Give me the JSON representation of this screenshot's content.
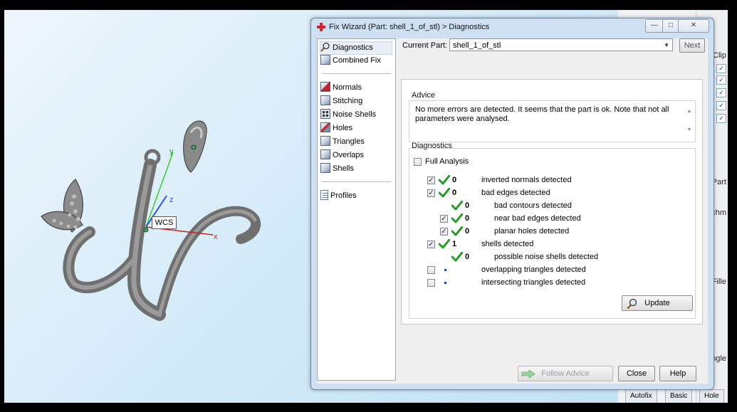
{
  "viewport": {
    "wcs_label": "WCS",
    "axis_x": "x",
    "axis_y": "y",
    "axis_z": "z"
  },
  "background_app": {
    "labels": [
      "Clip",
      "Part",
      "chm",
      "Fille",
      "ngle"
    ],
    "tabs": [
      "Autofix",
      "Basic",
      "Hole"
    ]
  },
  "dialog": {
    "title": "Fix Wizard (Part: shell_1_of_stl) > Diagnostics",
    "window_buttons": {
      "minimize": "—",
      "maximize": "□",
      "close": "✕"
    },
    "nav": {
      "top": [
        {
          "label": "Diagnostics",
          "icon": "magnifier-icon",
          "selected": true
        },
        {
          "label": "Combined Fix",
          "icon": "cube-icon"
        }
      ],
      "middle": [
        {
          "label": "Normals",
          "icon": "normals-cube-icon"
        },
        {
          "label": "Stitching",
          "icon": "stitching-cube-icon"
        },
        {
          "label": "Noise Shells",
          "icon": "noise-shells-icon"
        },
        {
          "label": "Holes",
          "icon": "holes-cube-icon"
        },
        {
          "label": "Triangles",
          "icon": "triangles-cube-icon"
        },
        {
          "label": "Overlaps",
          "icon": "overlaps-cube-icon"
        },
        {
          "label": "Shells",
          "icon": "shells-cube-icon"
        }
      ],
      "bottom": [
        {
          "label": "Profiles",
          "icon": "profiles-doc-icon"
        }
      ]
    },
    "current_part": {
      "label": "Current Part:",
      "value": "shell_1_of_stl",
      "next_label": "Next"
    },
    "advice": {
      "title": "Advice",
      "text": "No more errors are detected. It seems that the part is ok. Note that not all parameters were analysed."
    },
    "diagnostics": {
      "title": "Diagnostics",
      "full_analysis_label": "Full Analysis",
      "full_analysis_checked": false,
      "rows": [
        {
          "level": 0,
          "has_checkbox": true,
          "checked": true,
          "status": "ok",
          "count": "0",
          "label": "inverted normals detected"
        },
        {
          "level": 0,
          "has_checkbox": true,
          "checked": true,
          "status": "ok",
          "count": "0",
          "label": "bad edges detected"
        },
        {
          "level": 1,
          "has_checkbox": false,
          "checked": false,
          "status": "ok",
          "count": "0",
          "label": "bad contours detected"
        },
        {
          "level": 1,
          "has_checkbox": true,
          "checked": true,
          "status": "ok",
          "count": "0",
          "label": "near bad edges detected"
        },
        {
          "level": 1,
          "has_checkbox": true,
          "checked": true,
          "status": "ok",
          "count": "0",
          "label": "planar holes detected"
        },
        {
          "level": 0,
          "has_checkbox": true,
          "checked": true,
          "status": "ok",
          "count": "1",
          "label": "shells detected"
        },
        {
          "level": 1,
          "has_checkbox": false,
          "checked": false,
          "status": "ok",
          "count": "0",
          "label": "possible noise shells detected"
        },
        {
          "level": 0,
          "has_checkbox": true,
          "checked": false,
          "status": "pending",
          "count": "",
          "label": "overlapping triangles detected"
        },
        {
          "level": 0,
          "has_checkbox": true,
          "checked": false,
          "status": "pending",
          "count": "",
          "label": "intersecting triangles detected"
        }
      ],
      "update_label": "Update"
    },
    "buttons": {
      "follow_advice": "Follow Advice",
      "follow_advice_enabled": false,
      "close": "Close",
      "help": "Help"
    }
  },
  "colors": {
    "check_green": "#2a9a2a",
    "pending_dot": "#2442a6",
    "title_cross": "#d6212e"
  }
}
